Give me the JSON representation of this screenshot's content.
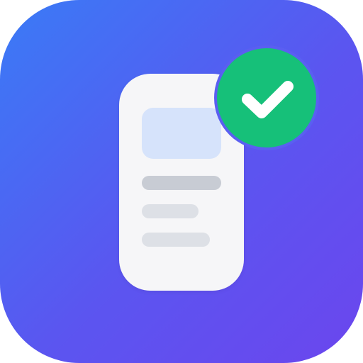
{
  "app_icon": {
    "name": "document-approved-app-icon",
    "colors": {
      "background_start": "#3a7bf6",
      "background_end": "#6b46ee",
      "card": "#f6f6f8",
      "preview_block": "#d6e3fb",
      "primary_line": "#c8ccd4",
      "secondary_line": "#dde0e6",
      "check_badge": "#16c079",
      "check_mark": "#ffffff"
    },
    "icons": {
      "device": "mobile-phone-icon",
      "status": "check-icon"
    }
  }
}
